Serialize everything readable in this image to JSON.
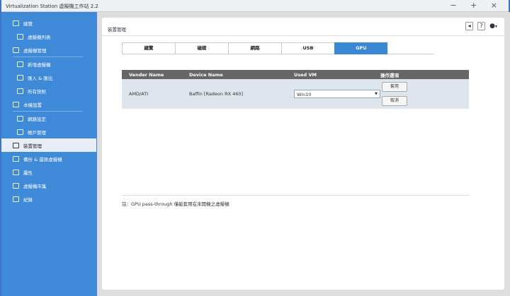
{
  "window": {
    "title": "Virtualization Station 虛擬機工作站 2.2",
    "controls": [
      "−",
      "+",
      "×"
    ]
  },
  "sidebar": {
    "items": [
      {
        "label": "總覽",
        "sub": false
      },
      {
        "label": "虛擬機列表",
        "sub": true
      },
      {
        "label": "虛擬機管理",
        "sub": false
      },
      {
        "label": "新增虛擬機",
        "sub": true
      },
      {
        "label": "匯入 & 匯出",
        "sub": true
      },
      {
        "label": "所有快照",
        "sub": true
      },
      {
        "label": "本機設置",
        "sub": false
      },
      {
        "label": "網路設定",
        "sub": true
      },
      {
        "label": "帳戶管理",
        "sub": true
      },
      {
        "label": "裝置管理",
        "sub": false,
        "active": true
      },
      {
        "label": "備份 & 還原虛擬機",
        "sub": false
      },
      {
        "label": "屬性",
        "sub": false
      },
      {
        "label": "虛擬機市集",
        "sub": false
      },
      {
        "label": "紀錄",
        "sub": false
      }
    ]
  },
  "header": {
    "title": "裝置管理",
    "help": "?",
    "user": "▾"
  },
  "tabs": [
    "總覽",
    "磁碟",
    "網路",
    "USB",
    "GPU"
  ],
  "table": {
    "headers": [
      "Vender Name",
      "Device Name",
      "Used VM",
      "操作選項"
    ],
    "rows": [
      {
        "vendor": "AMD/ATI",
        "device": "Baffin [Radeon RX 460]",
        "vm": "Win10",
        "apply": "套用",
        "cancel": "取消"
      }
    ]
  },
  "note": "註：GPU pass-through 僅能套用在未開機之虛擬機"
}
